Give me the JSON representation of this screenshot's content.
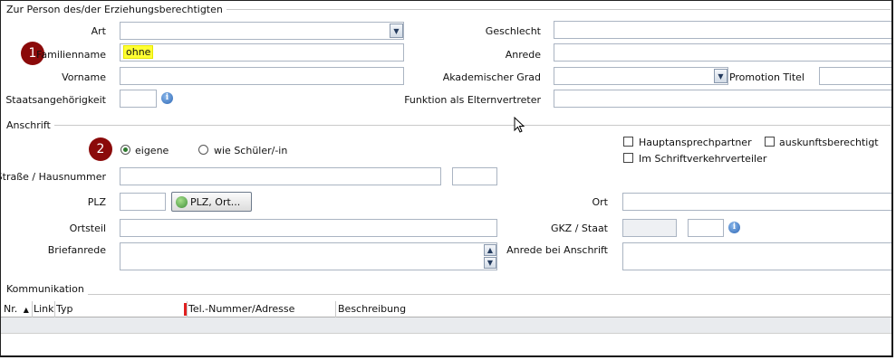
{
  "sections": {
    "person": "Zur Person des/der Erziehungsberechtigten",
    "address": "Anschrift",
    "communication": "Kommunikation"
  },
  "person": {
    "art_label": "Art",
    "art_value": "",
    "familienname_label": "Familienname",
    "familienname_value": "ohne",
    "vorname_label": "Vorname",
    "vorname_value": "",
    "staatsangehoerigkeit_label": "Staatsangehörigkeit",
    "staatsangehoerigkeit_value": "",
    "geschlecht_label": "Geschlecht",
    "anrede_label": "Anrede",
    "akademischer_grad_label": "Akademischer Grad",
    "promotion_titel_label": "Promotion Titel",
    "funktion_label": "Funktion als Elternvertreter"
  },
  "address": {
    "radio_eigene": "eigene",
    "radio_wie_schueler": "wie Schüler/-in",
    "selected": "eigene",
    "hauptansprechpartner": "Hauptansprechpartner",
    "auskunftsberechtigt": "auskunftsberechtigt",
    "schriftverkehrverteiler": "Im Schriftverkehrverteiler",
    "strasse_label": "Straße / Hausnummer",
    "plz_label": "PLZ",
    "plz_button": "PLZ, Ort...",
    "ort_label": "Ort",
    "ortsteil_label": "Ortsteil",
    "gkz_label": "GKZ / Staat",
    "briefanrede_label": "Briefanrede",
    "anrede_anschrift_label": "Anrede bei Anschrift"
  },
  "communication": {
    "columns": [
      "Nr.",
      "Link",
      "Typ",
      "Tel.-Nummer/Adresse",
      "Beschreibung"
    ]
  },
  "annotations": [
    "1",
    "2"
  ],
  "colors": {
    "badge": "#8b0a0a",
    "highlight": "#ffff33",
    "sort_marker": "#e02020"
  }
}
